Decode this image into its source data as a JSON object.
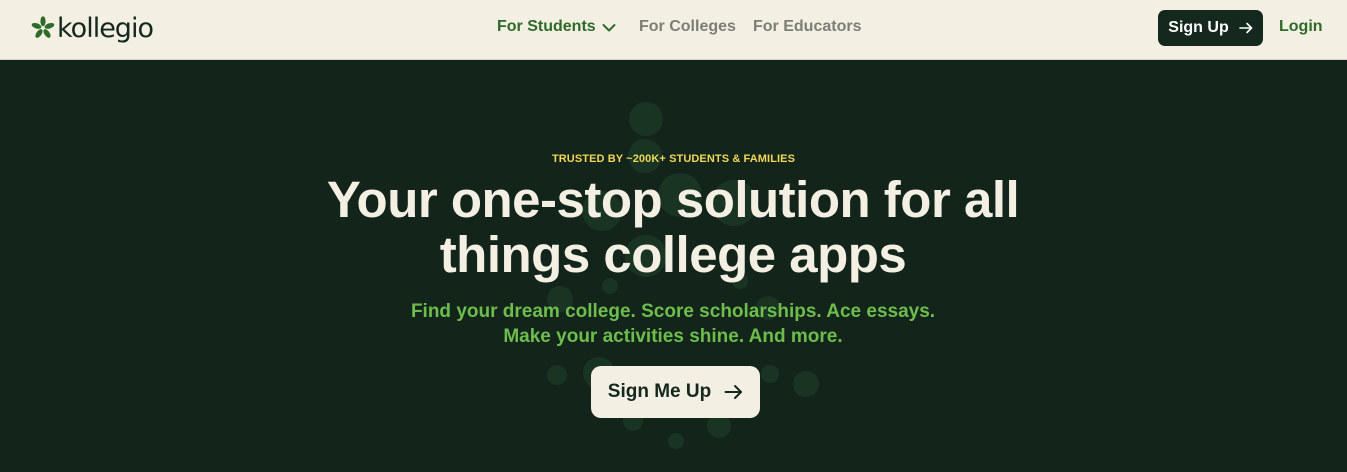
{
  "brand": {
    "name": "kollegio",
    "logo_icon": "flower-asterisk-icon",
    "color": "#15281d"
  },
  "nav": {
    "items": [
      {
        "label": "For Students",
        "active": true,
        "has_dropdown": true
      },
      {
        "label": "For Colleges",
        "active": false
      },
      {
        "label": "For Educators",
        "active": false
      }
    ],
    "dropdown_icon": "chevron-down-icon"
  },
  "header_actions": {
    "signup_label": "Sign Up",
    "signup_icon": "arrow-right-icon",
    "login_label": "Login"
  },
  "hero": {
    "eyebrow": "TRUSTED BY ~200K+ STUDENTS & FAMILIES",
    "headline": "Your one-stop solution for all things college apps",
    "subhead_lines": [
      "Find your dream college. Score scholarships. Ace essays.",
      "Make your activities shine. And more."
    ],
    "cta_label": "Sign Me Up",
    "cta_icon": "arrow-right-icon"
  },
  "colors": {
    "header_bg": "#f3efe3",
    "hero_bg": "#13241a",
    "accent_green": "#2e6b2a",
    "subhead_green": "#6dbd4d",
    "eyebrow_yellow": "#f1d757",
    "decor_circle": "#1d3a26"
  }
}
